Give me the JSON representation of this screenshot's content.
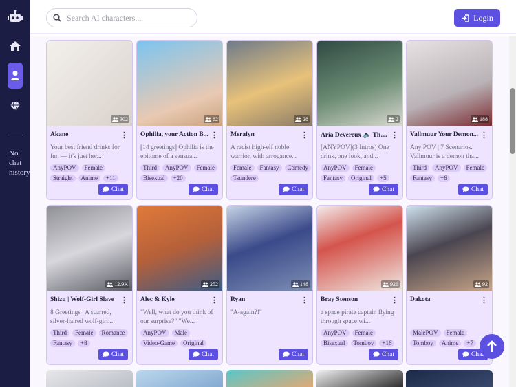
{
  "search": {
    "placeholder": "Search AI characters..."
  },
  "header": {
    "login_label": "Login"
  },
  "sidebar": {
    "empty_text": "No chat history"
  },
  "chat_label": "Chat",
  "colors": {
    "accent": "#5b50e0",
    "sidebar_bg": "#1c1d44",
    "card_bg": "#efe4ff",
    "tag_bg": "#dccaf7"
  },
  "cards": [
    {
      "name": "Akane",
      "count": "302",
      "desc": "Your best friend drinks for fun — it's just her...",
      "tags": [
        "AnyPOV",
        "Female",
        "Straight",
        "Anime",
        "+11"
      ],
      "gradient": "linear-gradient(135deg,#f3f0ec,#d9d2cb)"
    },
    {
      "name": "Ophilia, your Action B...",
      "count": "82",
      "desc": "[14 greetings] Ophilia is the epitome of a sensua...",
      "tags": [
        "Third",
        "AnyPOV",
        "Female",
        "Bisexual",
        "+20"
      ],
      "gradient": "linear-gradient(160deg,#7cc4f0,#e9c9b2 70%,#caa27e)"
    },
    {
      "name": "Meralyn",
      "count": "28",
      "desc": "A racist high-elf noble warrior, with arrogance...",
      "tags": [
        "Female",
        "Fantasy",
        "Comedy",
        "Tsundere"
      ],
      "gradient": "linear-gradient(160deg,#6e7a8a,#e8c27a 55%,#8a7b68)"
    },
    {
      "name": "Aria Devereux 🔈 The ...",
      "count": "2",
      "desc": "[ANYPOV](3 Intros) One drink, one look, and...",
      "tags": [
        "AnyPOV",
        "Female",
        "Fantasy",
        "Original",
        "+5"
      ],
      "gradient": "linear-gradient(160deg,#2f4a44,#6c8c73 55%,#d8d8d0)"
    },
    {
      "name": "Vallmuur Your Demon...",
      "count": "188",
      "desc": "Any POV | 7 Scenarios. Vallmuur is a demon tha...",
      "tags": [
        "Third",
        "AnyPOV",
        "Female",
        "Fantasy",
        "+6"
      ],
      "gradient": "linear-gradient(160deg,#e8e2e4,#b9b2b6 60%,#7a2a30)"
    },
    {
      "name": "Shizu | Wolf-Girl Slave",
      "count": "12.9K",
      "desc": "8 Greetings | A scarred, silver-haired wolf-girl...",
      "tags": [
        "Third",
        "Female",
        "Romance",
        "Fantasy",
        "+8"
      ],
      "gradient": "linear-gradient(160deg,#8f8f96,#d7d7dc 50%,#5c5c66)"
    },
    {
      "name": "Alec & Kyle",
      "count": "252",
      "desc": "\"Well, what do you think of our surprise?\" \"We...",
      "tags": [
        "AnyPOV",
        "Male",
        "Video-Game",
        "Original"
      ],
      "gradient": "linear-gradient(160deg,#e07a3a,#b5603a 50%,#3d5c86)"
    },
    {
      "name": "Ryan",
      "count": "148",
      "desc": "\"A-again?!\"",
      "tags": [],
      "gradient": "linear-gradient(160deg,#c8d4e6,#3a4a8a 45%,#7e8eb4)"
    },
    {
      "name": "Bray Stenson",
      "count": "926",
      "desc": "a space pirate captain flying through space wi...",
      "tags": [
        "AnyPOV",
        "Female",
        "Bisexual",
        "Tomboy",
        "+16"
      ],
      "gradient": "linear-gradient(160deg,#f2eeee,#d4544c 40%,#efe7e2)"
    },
    {
      "name": "Dakota",
      "count": "92",
      "desc": "",
      "tags": [
        "MalePOV",
        "Female",
        "Tomboy",
        "Anime",
        "+7"
      ],
      "gradient": "linear-gradient(160deg,#cfe3ef,#4a4550 45%,#c7a487)"
    }
  ],
  "partial_row": [
    "linear-gradient(160deg,#e8e8ea,#b8bcc4)",
    "linear-gradient(160deg,#bcd8ee,#7fa6cf)",
    "linear-gradient(160deg,#5ac7c9,#e8a76f)",
    "linear-gradient(160deg,#f0f0f0,#202022)",
    "linear-gradient(160deg,#1c2a48,#3a4a70)"
  ]
}
